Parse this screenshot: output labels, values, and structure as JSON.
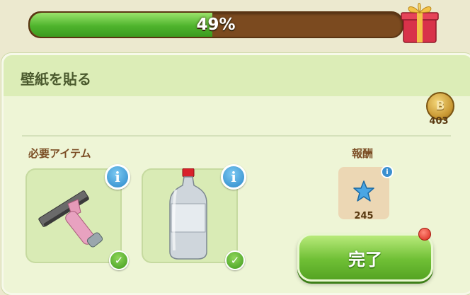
{
  "progress": {
    "value": 0.49,
    "label": "49%"
  },
  "task": {
    "title": "壁紙を貼る"
  },
  "currency": {
    "value": "403"
  },
  "required_items": {
    "label": "必要アイテム",
    "items": [
      {
        "name": "squeegee",
        "info_icon": "i",
        "complete": true
      },
      {
        "name": "bottle",
        "info_icon": "i",
        "complete": true
      }
    ]
  },
  "reward": {
    "label": "報酬",
    "value": "245",
    "icon": "blue-star-icon"
  },
  "done_button": {
    "label": "完了"
  },
  "icons": {
    "info": "i",
    "check": "✓",
    "coin_letter": "B"
  },
  "colors": {
    "progress_fill": "#4fb42d",
    "progress_track": "#7b4a1f",
    "button": "#6fbf35",
    "info": "#2a87c9"
  }
}
